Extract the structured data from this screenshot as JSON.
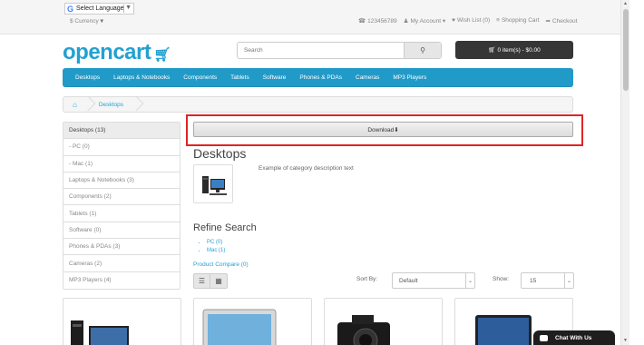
{
  "topbar": {
    "translate_label": "Select Language",
    "currency": "$ Currency",
    "links": [
      {
        "icon": "phone-icon",
        "glyph": "☎",
        "label": "123456789"
      },
      {
        "icon": "user-icon",
        "glyph": "♟",
        "label": "My Account ▾"
      },
      {
        "icon": "heart-icon",
        "glyph": "♥",
        "label": "Wish List (0)"
      },
      {
        "icon": "cart-icon",
        "glyph": "≡",
        "label": "Shopping Cart"
      },
      {
        "icon": "share-icon",
        "glyph": "➦",
        "label": "Checkout"
      }
    ]
  },
  "header": {
    "logo": "opencart",
    "search_placeholder": "Search",
    "cart_label": "0 item(s) - $0.00"
  },
  "nav": [
    "Desktops",
    "Laptops & Notebooks",
    "Components",
    "Tablets",
    "Software",
    "Phones & PDAs",
    "Cameras",
    "MP3 Players"
  ],
  "breadcrumb": {
    "current": "Desktops"
  },
  "sidebar": [
    {
      "label": "Desktops (13)",
      "active": true
    },
    {
      "label": "- PC (0)",
      "active": false
    },
    {
      "label": "- Mac (1)",
      "active": false
    },
    {
      "label": "Laptops & Notebooks (3)",
      "active": false
    },
    {
      "label": "Components (2)",
      "active": false
    },
    {
      "label": "Tablets (1)",
      "active": false
    },
    {
      "label": "Software (0)",
      "active": false
    },
    {
      "label": "Phones & PDAs (3)",
      "active": false
    },
    {
      "label": "Cameras (2)",
      "active": false
    },
    {
      "label": "MP3 Players (4)",
      "active": false
    }
  ],
  "download_label": "Download⬇",
  "content": {
    "title": "Desktops",
    "description": "Example of category description text",
    "refine_title": "Refine Search",
    "refine_items": [
      "PC (0)",
      "Mac (1)"
    ],
    "compare": "Product Compare (0)",
    "sort_label": "Sort By:",
    "sort_value": "Default",
    "show_label": "Show:",
    "show_value": "15"
  },
  "chat_label": "Chat With Us"
}
